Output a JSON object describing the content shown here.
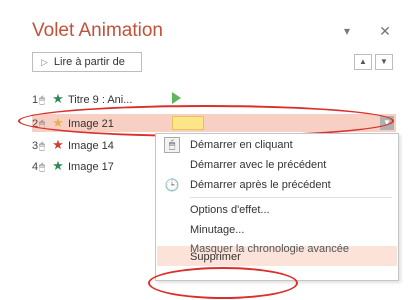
{
  "pane": {
    "title": "Volet Animation",
    "play_label": "Lire à partir de"
  },
  "animations": [
    {
      "order": "1",
      "name": "Titre 9 : Ani...",
      "star_color": "#2e8b57"
    },
    {
      "order": "2",
      "name": "Image 21",
      "star_color": "#e8b24c"
    },
    {
      "order": "3",
      "name": "Image 14",
      "star_color": "#d23f2b"
    },
    {
      "order": "4",
      "name": "Image 17",
      "star_color": "#2e8b57"
    }
  ],
  "menu": {
    "start_on_click": "Démarrer en cliquant",
    "start_with_previous": "Démarrer avec le précédent",
    "start_after_previous": "Démarrer après le précédent",
    "effect_options": "Options d'effet...",
    "timing": "Minutage...",
    "hide_timeline": "Masquer la chronologie avancée",
    "remove": "Supprimer"
  },
  "icons": {
    "dropdown": "chevron-down-icon",
    "close": "close-icon",
    "clock": "clock-icon",
    "mouse": "mouse-icon",
    "star": "star-icon"
  }
}
